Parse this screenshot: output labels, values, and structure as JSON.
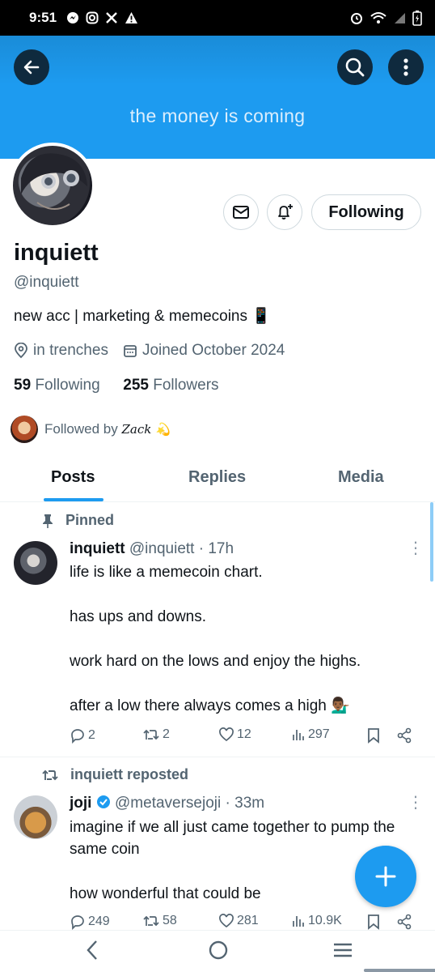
{
  "status_bar": {
    "time": "9:51"
  },
  "banner": {
    "text": "the money is coming"
  },
  "profile": {
    "name": "inquiett",
    "handle": "@inquiett",
    "bio": "new acc | marketing & memecoins 📱",
    "location": "in trenches",
    "joined": "Joined October 2024",
    "following_count": "59",
    "following_label": "Following",
    "followers_count": "255",
    "followers_label": "Followers",
    "followed_by_prefix": "Followed by",
    "followed_by_name": "Zack 💫",
    "follow_button": "Following"
  },
  "tabs": [
    {
      "label": "Posts",
      "active": true
    },
    {
      "label": "Replies",
      "active": false
    },
    {
      "label": "Media",
      "active": false
    }
  ],
  "posts": [
    {
      "context": "Pinned",
      "author": "inquiett",
      "handle": "@inquiett",
      "time": "· 17h",
      "lines": [
        "life is like a memecoin chart.",
        "has ups and downs.",
        "work hard on the lows and enjoy the highs.",
        "after a low there always comes a high 💁🏾‍♂️"
      ],
      "replies": "2",
      "reposts": "2",
      "likes": "12",
      "views": "297"
    },
    {
      "context": "inquiett reposted",
      "author": "joji",
      "handle": "@metaversejoji",
      "time": "· 33m",
      "lines": [
        "imagine if we all just came together to pump the same coin",
        "how wonderful that could be"
      ],
      "replies": "249",
      "reposts": "58",
      "likes": "281",
      "views": "10.9K"
    }
  ],
  "colors": {
    "accent": "#1d9bf0",
    "text": "#0f1419",
    "muted": "#536471"
  }
}
